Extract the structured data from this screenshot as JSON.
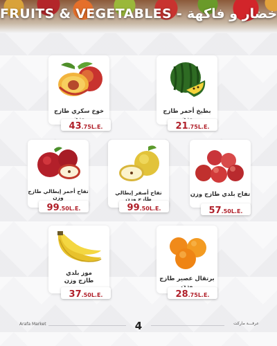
{
  "header": {
    "title": "FRUITS & VEGETABLES - خضار و فاكهة"
  },
  "products": [
    {
      "name": "خوخ سكري طازج وزن",
      "price_int": "43",
      "price_dec": ".75",
      "currency": "L.E."
    },
    {
      "name": "بطيخ أحمر طازج وزن",
      "price_int": "21",
      "price_dec": ".75",
      "currency": "L.E."
    },
    {
      "name": "تفاح أحمر إيطالي طازج وزن",
      "price_int": "99",
      "price_dec": ".50",
      "currency": "L.E."
    },
    {
      "name": "تفاح أصفر إيطالي طازج وزن",
      "price_int": "99",
      "price_dec": ".50",
      "currency": "L.E."
    },
    {
      "name": "تفاح بلدي طازج وزن",
      "price_int": "57",
      "price_dec": ".50",
      "currency": "L.E."
    },
    {
      "name_line1": "موز بلدي",
      "name_line2": "طازج وزن",
      "price_int": "37",
      "price_dec": ".50",
      "currency": "L.E."
    },
    {
      "name": "برتقال عصير طازج وزن",
      "price_int": "28",
      "price_dec": ".75",
      "currency": "L.E."
    }
  ],
  "footer": {
    "left": "Arafa Market",
    "page": "4",
    "right": "عرفـــة ماركت"
  }
}
